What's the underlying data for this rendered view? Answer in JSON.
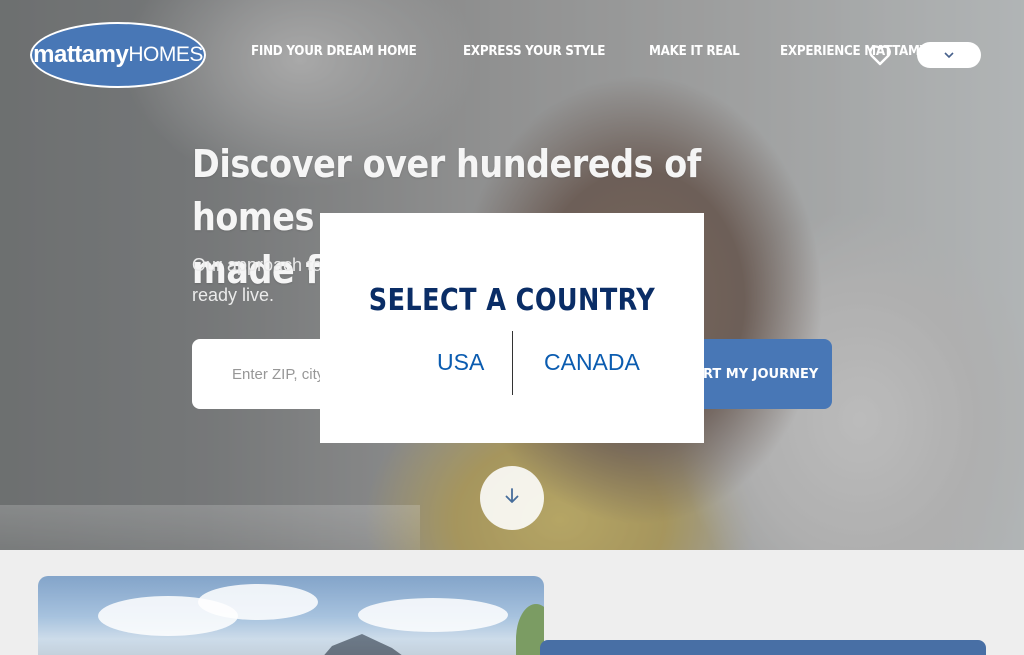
{
  "brand": {
    "logo_primary": "mattamy",
    "logo_secondary": "HOMES",
    "color": "#0b4a9e"
  },
  "nav": {
    "items": [
      {
        "label": "FIND YOUR DREAM HOME"
      },
      {
        "label": "EXPRESS YOUR STYLE"
      },
      {
        "label": "MAKE IT REAL"
      },
      {
        "label": "EXPERIENCE MATTAMY"
      }
    ],
    "favorites_icon": "heart-icon",
    "dropdown_icon": "chevron-down-icon"
  },
  "hero": {
    "headline_line1": "Discover over hundereds of homes",
    "headline_line2": "made for you",
    "subtext_line1": "Our approach to homebuilding is about designing how you",
    "subtext_line2": "ready live.",
    "search_placeholder": "Enter ZIP, city or community",
    "cta_label": "START MY JOURNEY",
    "scroll_icon": "arrow-down-icon"
  },
  "modal": {
    "title": "SELECT A COUNTRY",
    "options": [
      "USA",
      "CANADA"
    ]
  }
}
